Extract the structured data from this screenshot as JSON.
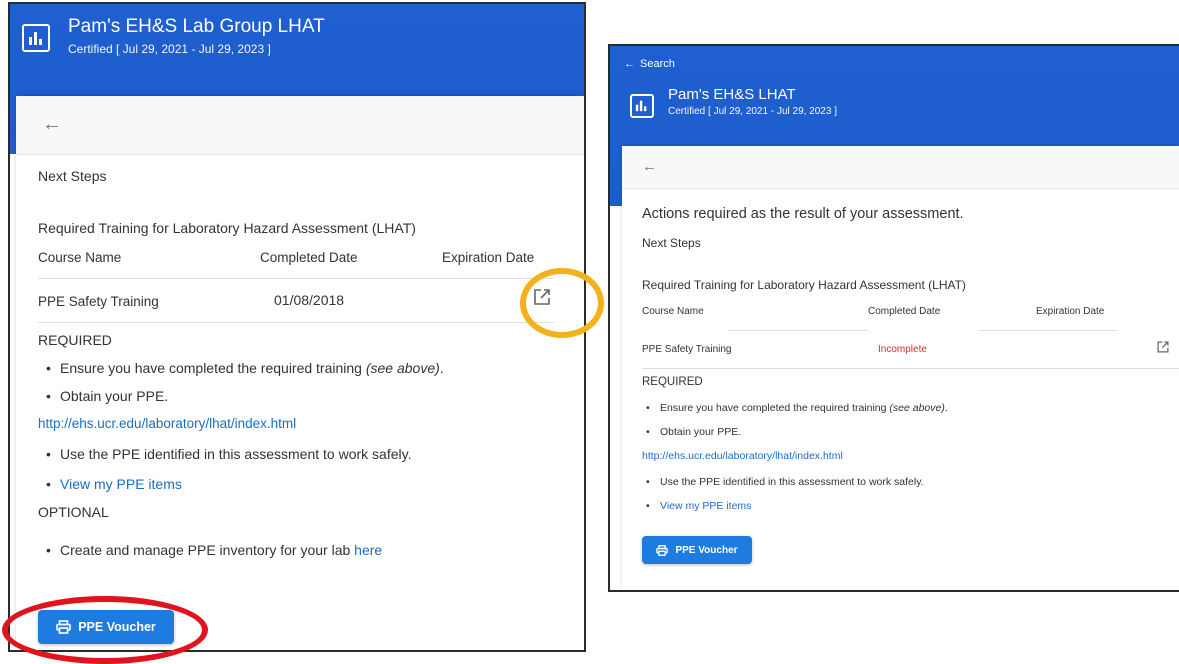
{
  "left": {
    "title": "Pam's EH&S Lab Group LHAT",
    "subtitle": "Certified [ Jul 29, 2021 - Jul 29, 2023 ]",
    "next_steps": "Next Steps",
    "training_heading": "Required Training for Laboratory Hazard Assessment (LHAT)",
    "columns": [
      "Course Name",
      "Completed Date",
      "Expiration Date"
    ],
    "row": {
      "course": "PPE Safety Training",
      "completed": "01/08/2018",
      "expiration": ""
    },
    "required_label": "REQUIRED",
    "req1_text": "Ensure you have completed the required training ",
    "req1_em": "(see above)",
    "req1_end": ".",
    "req2": "Obtain your PPE.",
    "link": "http://ehs.ucr.edu/laboratory/lhat/index.html",
    "req3": "Use the PPE identified in this assessment to work safely.",
    "view_ppe": "View my PPE items",
    "optional_label": "OPTIONAL",
    "opt1": "Create and manage PPE inventory for your lab ",
    "opt1_link": "here",
    "voucher": "PPE Voucher"
  },
  "right": {
    "search_back": "Search",
    "title": "Pam's EH&S LHAT",
    "subtitle": "Certified [ Jul 29, 2021 - Jul 29, 2023 ]",
    "actions": "Actions required as the result of your assessment.",
    "next_steps": "Next Steps",
    "training_heading": "Required Training for Laboratory Hazard Assessment (LHAT)",
    "columns": [
      "Course Name",
      "Completed Date",
      "Expiration Date"
    ],
    "row": {
      "course": "PPE Safety Training",
      "completed": "Incomplete",
      "expiration": ""
    },
    "required_label": "REQUIRED",
    "req1_text": "Ensure you have completed the required training ",
    "req1_em": "(see above)",
    "req1_end": ".",
    "req2": "Obtain your PPE.",
    "link": "http://ehs.ucr.edu/laboratory/lhat/index.html",
    "req3": "Use the PPE identified in this assessment to work safely.",
    "view_ppe": "View my PPE items",
    "voucher": "PPE Voucher"
  },
  "colors": {
    "header_blue": "#1f5fd0",
    "button_blue": "#1e7ce0",
    "link_blue": "#1b6ec2",
    "incomplete_red": "#d32f2f",
    "highlight_gold": "#f2b21c",
    "highlight_red": "#e0141e"
  },
  "icons": {
    "logo": "bar-chart-icon",
    "back": "arrow-left-icon",
    "open": "open-in-new-icon",
    "print": "printer-icon"
  }
}
